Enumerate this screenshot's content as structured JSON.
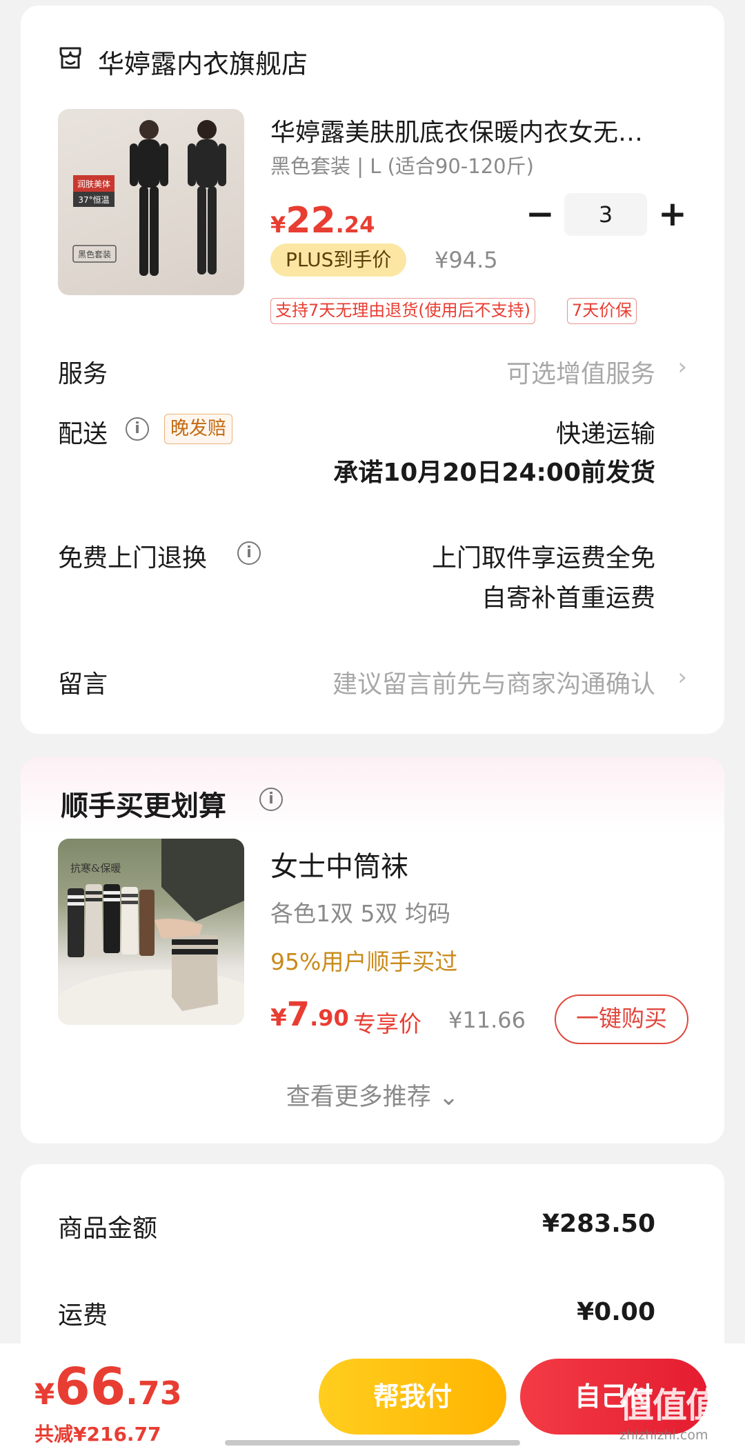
{
  "store": {
    "name": "华婷露内衣旗舰店",
    "icon": "store-icon"
  },
  "product": {
    "image_badge_1": "润肤美体",
    "image_badge_2": "37°恒温",
    "image_badge_3": "黑色套装",
    "title": "华婷露美肤肌底衣保暖内衣女无…",
    "spec": "黑色套装 | L (适合90-120斤)",
    "price_symbol": "¥",
    "price_int": "22",
    "price_dec": ".24",
    "quantity": "3",
    "minus": "−",
    "plus": "+",
    "plus_tag": "PLUS到手价",
    "plus_price": "¥94.5",
    "service_tag_1": "支持7天无理由退货(使用后不支持)",
    "service_tag_2": "7天价保"
  },
  "rows": {
    "service_label": "服务",
    "service_value": "可选增值服务",
    "delivery_label": "配送",
    "delivery_tag": "晚发赔",
    "delivery_value_1": "快递运输",
    "delivery_value_2": "承诺10月20日24:00前发货",
    "return_label": "免费上门退换",
    "return_value_1": "上门取件享运费全免",
    "return_value_2": "自寄补首重运费",
    "message_label": "留言",
    "message_placeholder": "建议留言前先与商家沟通确认",
    "chevron": "›"
  },
  "addon": {
    "title": "顺手买更划算",
    "image_text": "抗寒&保暖",
    "name": "女士中筒袜",
    "spec": "各色1双 5双   均码",
    "popularity": "95%用户顺手买过",
    "price_symbol": "¥",
    "price_int": "7",
    "price_dec": ".90",
    "price_label": "专享价",
    "orig_price": "¥11.66",
    "buy_button": "一键购买",
    "more": "查看更多推荐 ⌄"
  },
  "summary": {
    "goods_label": "商品金额",
    "goods_value": "¥283.50",
    "shipping_label": "运费",
    "shipping_value": "¥0.00"
  },
  "bottom": {
    "total_symbol": "¥",
    "total_int": "66",
    "total_dec": ".73",
    "total_saved": "共减¥216.77",
    "help_pay": "帮我付",
    "self_pay": "自己付"
  },
  "watermark": {
    "main": "值值值",
    "sub": "zhizhizhi.com"
  },
  "colors": {
    "accent_red": "#e83d32",
    "plus_gold": "#fbe7a3",
    "help_yellow": "#ffc107"
  }
}
